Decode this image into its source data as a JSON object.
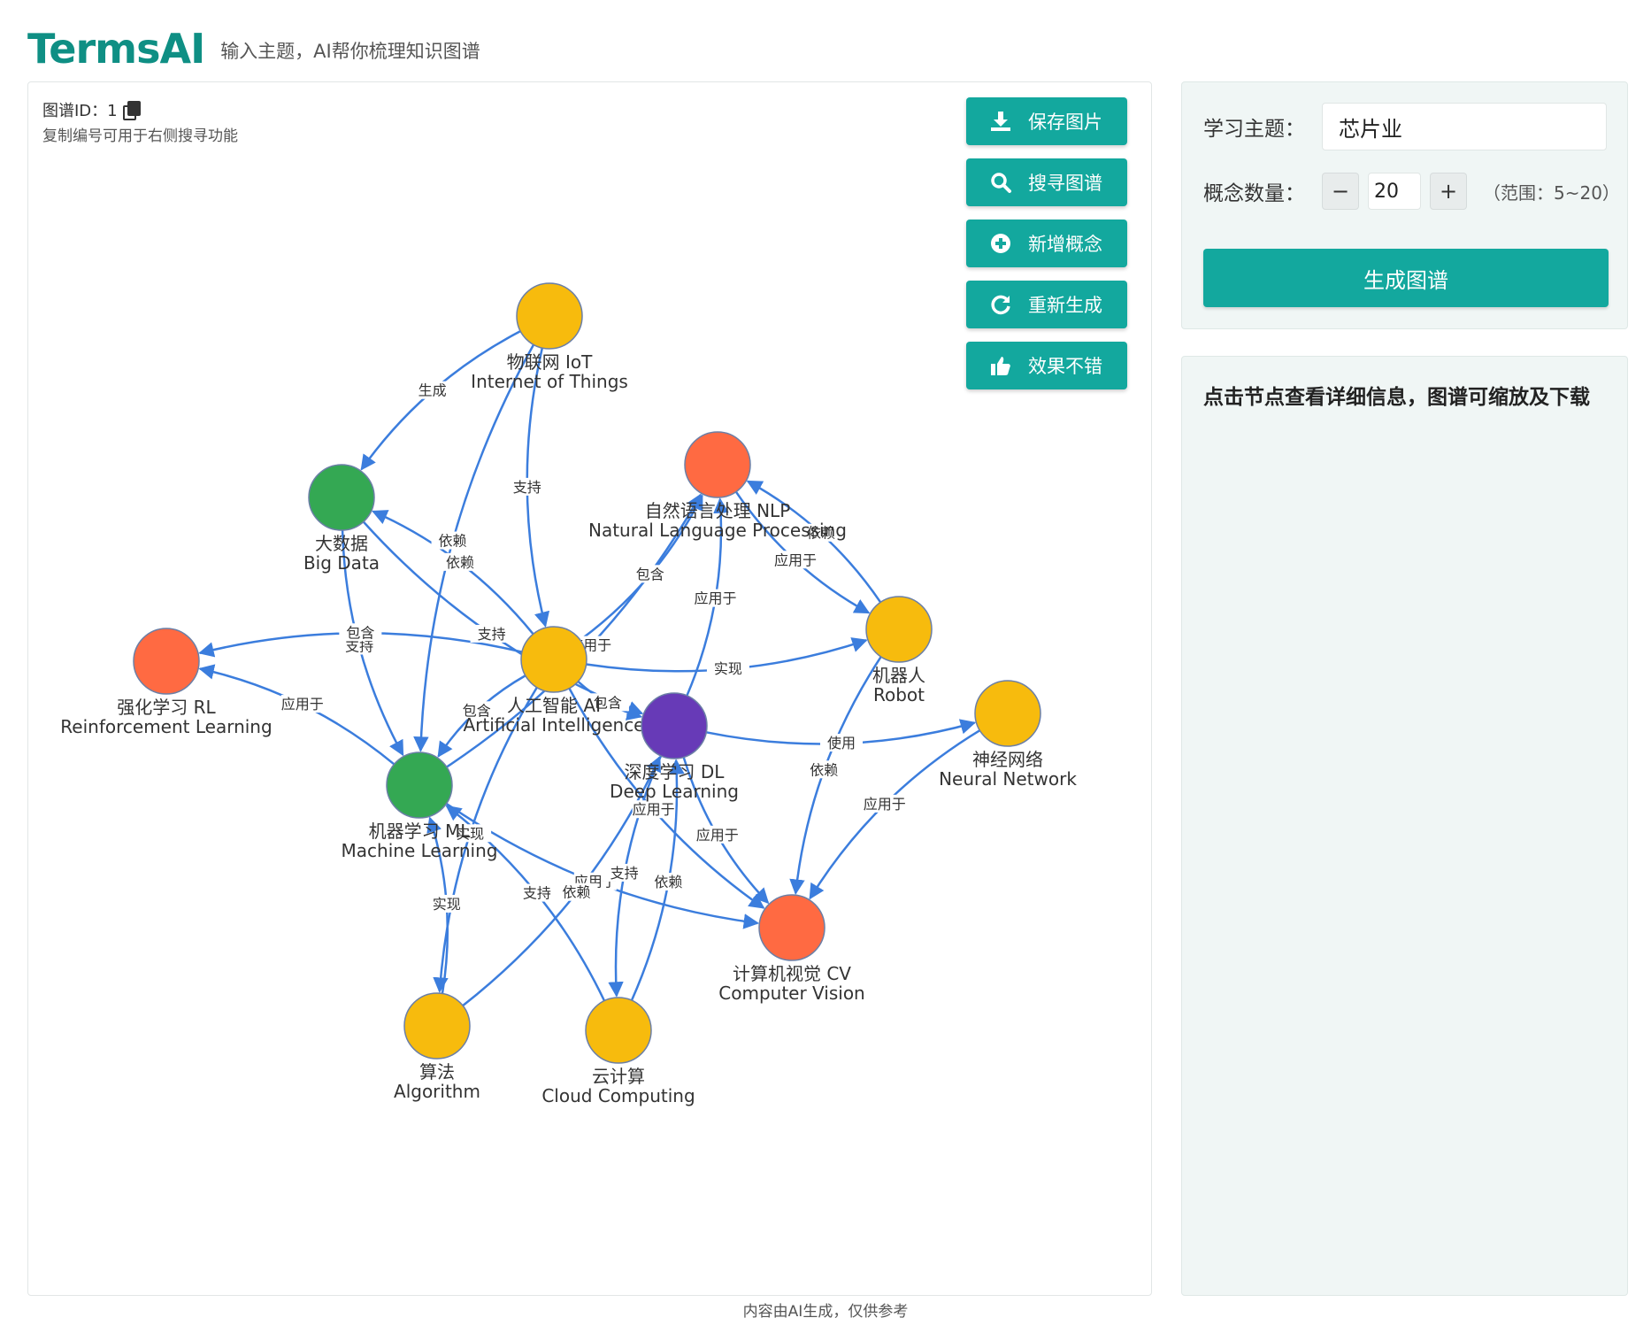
{
  "header": {
    "brand": "TermsAI",
    "tagline": "输入主题，AI帮你梳理知识图谱"
  },
  "graph_panel": {
    "graph_id_label": "图谱ID：1",
    "hint": "复制编号可用于右侧搜寻功能",
    "actions": [
      {
        "label": "保存图片",
        "icon": "download-icon"
      },
      {
        "label": "搜寻图谱",
        "icon": "search-icon"
      },
      {
        "label": "新增概念",
        "icon": "plus-circle-icon"
      },
      {
        "label": "重新生成",
        "icon": "refresh-icon"
      },
      {
        "label": "效果不错",
        "icon": "thumbs-up-icon"
      }
    ]
  },
  "graph": {
    "colors": {
      "yellow": "#f7bb0d",
      "green": "#34a853",
      "orange": "#ff6a42",
      "purple": "#673ab7",
      "edge": "#3b7ddd"
    },
    "nodes": [
      {
        "id": "iot",
        "zh": "物联网 IoT",
        "en": "Internet of Things",
        "color": "yellow"
      },
      {
        "id": "bigdata",
        "zh": "大数据",
        "en": "Big Data",
        "color": "green"
      },
      {
        "id": "nlp",
        "zh": "自然语言处理 NLP",
        "en": "Natural Language Processing",
        "color": "orange"
      },
      {
        "id": "robot",
        "zh": "机器人",
        "en": "Robot",
        "color": "yellow"
      },
      {
        "id": "rl",
        "zh": "强化学习 RL",
        "en": "Reinforcement Learning",
        "color": "orange"
      },
      {
        "id": "ai",
        "zh": "人工智能 AI",
        "en": "Artificial Intelligence",
        "color": "yellow"
      },
      {
        "id": "dl",
        "zh": "深度学习 DL",
        "en": "Deep Learning",
        "color": "purple"
      },
      {
        "id": "nn",
        "zh": "神经网络",
        "en": "Neural Network",
        "color": "yellow"
      },
      {
        "id": "ml",
        "zh": "机器学习 ML",
        "en": "Machine Learning",
        "color": "green"
      },
      {
        "id": "cv",
        "zh": "计算机视觉 CV",
        "en": "Computer Vision",
        "color": "orange"
      },
      {
        "id": "algo",
        "zh": "算法",
        "en": "Algorithm",
        "color": "yellow"
      },
      {
        "id": "cloud",
        "zh": "云计算",
        "en": "Cloud Computing",
        "color": "yellow"
      }
    ],
    "edges": [
      {
        "from": "iot",
        "to": "bigdata",
        "label": "生成"
      },
      {
        "from": "iot",
        "to": "ml",
        "label": "依赖"
      },
      {
        "from": "iot",
        "to": "ai",
        "label": "支持"
      },
      {
        "from": "bigdata",
        "to": "ml",
        "label": "支持"
      },
      {
        "from": "bigdata",
        "to": "dl",
        "label": "支持"
      },
      {
        "from": "ai",
        "to": "bigdata",
        "label": "依赖"
      },
      {
        "from": "ai",
        "to": "nlp",
        "label": "包含"
      },
      {
        "from": "ml",
        "to": "nlp",
        "label": "应用于"
      },
      {
        "from": "dl",
        "to": "nlp",
        "label": "应用于"
      },
      {
        "from": "robot",
        "to": "nlp",
        "label": "依赖"
      },
      {
        "from": "nlp",
        "to": "robot",
        "label": "应用于"
      },
      {
        "from": "ai",
        "to": "robot",
        "label": "实现"
      },
      {
        "from": "ai",
        "to": "rl",
        "label": "包含"
      },
      {
        "from": "ml",
        "to": "rl",
        "label": "应用于"
      },
      {
        "from": "ai",
        "to": "ml",
        "label": "包含"
      },
      {
        "from": "ai",
        "to": "dl",
        "label": "包含"
      },
      {
        "from": "dl",
        "to": "nn",
        "label": "使用"
      },
      {
        "from": "robot",
        "to": "cv",
        "label": "依赖"
      },
      {
        "from": "nn",
        "to": "cv",
        "label": "应用于"
      },
      {
        "from": "dl",
        "to": "cv",
        "label": "应用于"
      },
      {
        "from": "ml",
        "to": "cv",
        "label": "应用于"
      },
      {
        "from": "ai",
        "to": "cv",
        "label": "应用于"
      },
      {
        "from": "algo",
        "to": "ml",
        "label": "实现"
      },
      {
        "from": "ai",
        "to": "algo",
        "label": "实现"
      },
      {
        "from": "algo",
        "to": "dl",
        "label": "依赖"
      },
      {
        "from": "cloud",
        "to": "ml",
        "label": "支持"
      },
      {
        "from": "cloud",
        "to": "dl",
        "label": "依赖"
      },
      {
        "from": "dl",
        "to": "cloud",
        "label": "支持"
      }
    ]
  },
  "settings": {
    "topic_label": "学习主题：",
    "topic_value": "芯片业",
    "count_label": "概念数量：",
    "count_value": "20",
    "minus": "−",
    "plus": "+",
    "range": "（范围：5~20）",
    "generate": "生成图谱"
  },
  "info": {
    "text": "点击节点查看详细信息，图谱可缩放及下载"
  },
  "footer": "内容由AI生成，仅供参考"
}
